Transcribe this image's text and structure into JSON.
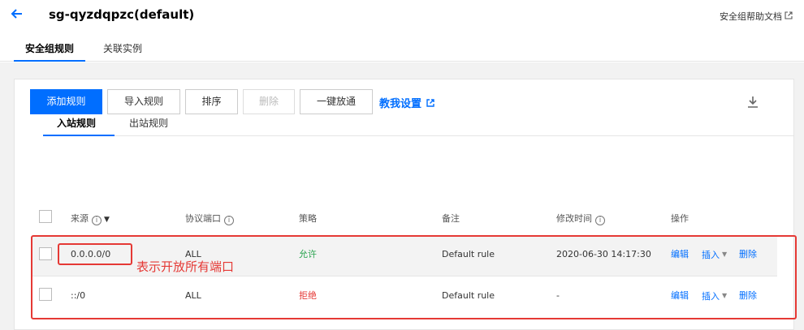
{
  "header": {
    "title": "sg-qyzdqpzc(default)",
    "help_link": "安全组帮助文档",
    "tabs": [
      {
        "label": "安全组规则",
        "active": true
      },
      {
        "label": "关联实例",
        "active": false
      }
    ]
  },
  "rules": {
    "tabs": [
      {
        "label": "入站规则",
        "active": true
      },
      {
        "label": "出站规则",
        "active": false
      }
    ],
    "toolbar": {
      "add": "添加规则",
      "import": "导入规则",
      "sort": "排序",
      "delete": "删除",
      "allow_all": "一键放通",
      "teach": "教我设置"
    },
    "columns": {
      "source": "来源",
      "port": "协议端口",
      "policy": "策略",
      "remark": "备注",
      "modified": "修改时间",
      "actions": "操作"
    },
    "rows": [
      {
        "source": "0.0.0.0/0",
        "port": "ALL",
        "policy": "允许",
        "remark": "Default rule",
        "modified": "2020-06-30 14:17:30",
        "edit": "编辑",
        "insert": "插入",
        "delete": "删除"
      },
      {
        "source": "::/0",
        "port": "ALL",
        "policy": "拒绝",
        "remark": "Default rule",
        "modified": "-",
        "edit": "编辑",
        "insert": "插入",
        "delete": "删除"
      }
    ]
  },
  "annotation": "表示开放所有端口",
  "colors": {
    "primary": "#006eff",
    "allow": "#2aa44f",
    "deny": "#e53935",
    "annotation": "#e53935"
  },
  "icons": [
    "back-arrow-icon",
    "external-link-icon",
    "info-icon",
    "filter-icon",
    "download-icon",
    "caret-down-icon"
  ]
}
